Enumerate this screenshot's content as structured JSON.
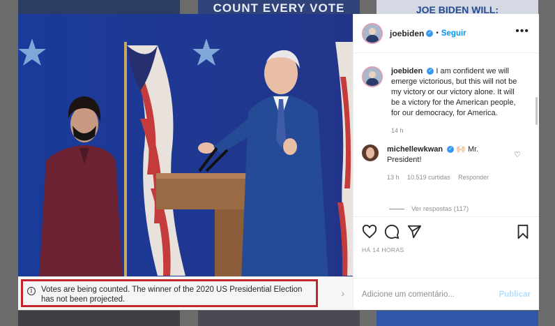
{
  "background": {
    "tile_vote_text": "COUNT EVERY VOTE",
    "tile_biden_text": "JOE BIDEN WILL:"
  },
  "post": {
    "username": "joebiden",
    "separator": "•",
    "follow_label": "Seguir",
    "more_label": "•••",
    "caption_user": "joebiden",
    "caption": "I am confident we will emerge victorious, but this will not be my victory or our victory alone. It will be a victory for the American people, for our democracy, for America.",
    "caption_time": "14 h",
    "comment": {
      "user": "michellewkwan",
      "text": "🙌🏻 Mr. President!",
      "time": "13 h",
      "likes": "10.519 curtidas",
      "reply_label": "Responder"
    },
    "view_replies": "Ver respostas (117)",
    "posted_ago": "HÁ 14 HORAS",
    "add_comment_placeholder": "Adicione um comentário...",
    "publish_label": "Publicar"
  },
  "notice": {
    "text": "Votes are being counted. The winner of the 2020 US Presidential Election has not been projected.",
    "info_icon": "i",
    "chevron": "›"
  },
  "icons": [
    "verified-badge-icon",
    "heart-icon",
    "comment-icon",
    "share-icon",
    "bookmark-icon",
    "info-icon",
    "chevron-right-icon"
  ],
  "colors": {
    "accent": "#0095f6",
    "notice_border": "#c0272d"
  }
}
